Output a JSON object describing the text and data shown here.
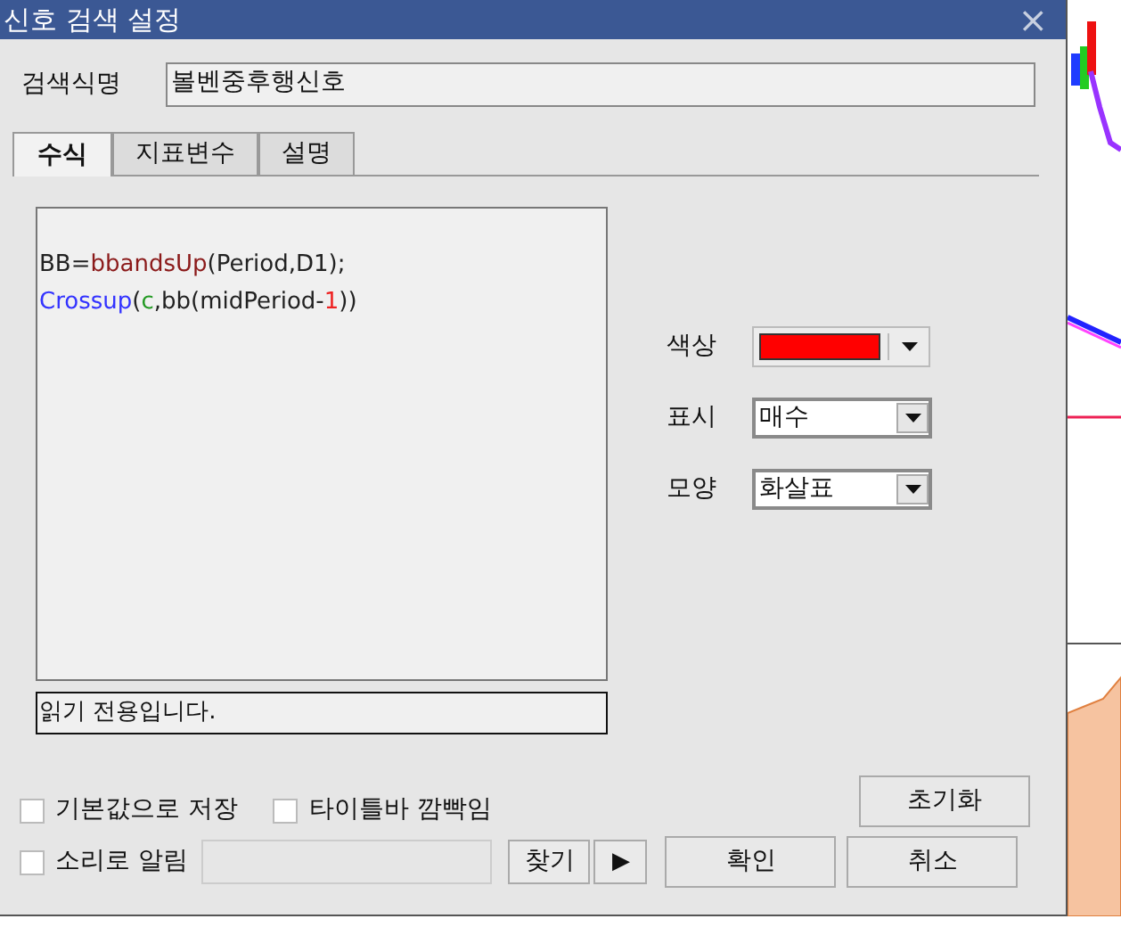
{
  "window": {
    "title": "신호 검색 설정",
    "close": "×"
  },
  "name_field": {
    "label": "검색식명",
    "value": "볼벤중후행신호"
  },
  "tabs": [
    {
      "label": "수식",
      "selected": true
    },
    {
      "label": "지표변수",
      "selected": false
    },
    {
      "label": "설명",
      "selected": false
    }
  ],
  "code_lines": [
    [
      {
        "text": "BB=",
        "kind": "plain"
      },
      {
        "text": "bbandsUp",
        "kind": "function"
      },
      {
        "text": "(Period,D1);",
        "kind": "plain"
      }
    ],
    [
      {
        "text": "Crossup",
        "kind": "keyword"
      },
      {
        "text": "(",
        "kind": "plain"
      },
      {
        "text": "c",
        "kind": "variable"
      },
      {
        "text": ",bb(midPeriod-",
        "kind": "plain"
      },
      {
        "text": "1",
        "kind": "number"
      },
      {
        "text": "))",
        "kind": "plain"
      }
    ]
  ],
  "status_text": "읽기 전용입니다.",
  "settings": [
    {
      "label": "색상",
      "kind": "color",
      "color": "#ff0000"
    },
    {
      "label": "표시",
      "kind": "select",
      "value": "매수"
    },
    {
      "label": "모양",
      "kind": "select",
      "value": "화살표"
    }
  ],
  "options": [
    {
      "label": "기본값으로 저장",
      "checked": false
    },
    {
      "label": "타이틀바 깜빡임",
      "checked": false
    }
  ],
  "sound": {
    "label": "소리로 알림",
    "checked": false,
    "find_button": "찾기",
    "play_button": "▶"
  },
  "buttons": {
    "reset": "초기화",
    "ok": "확인",
    "cancel": "취소"
  }
}
